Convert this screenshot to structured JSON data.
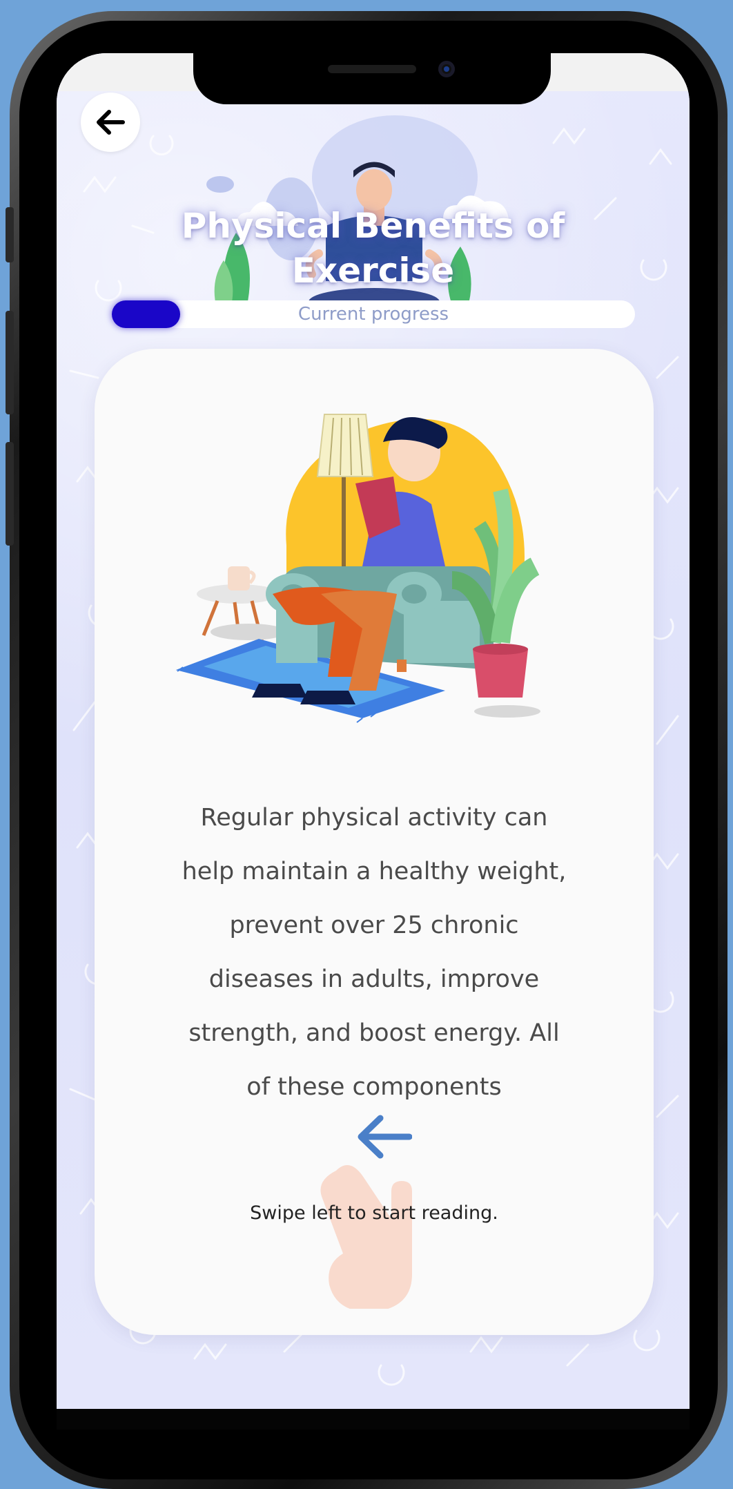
{
  "header": {
    "back_icon": "arrow-left-icon",
    "title_line1": "Physical Benefits  of",
    "title_line2": "Exercise"
  },
  "progress": {
    "label": "Current progress",
    "value_fraction": 0.13,
    "fill_color": "#1a06c8"
  },
  "card": {
    "illustration": "man-reading-on-couch-illustration",
    "body_lines": [
      "Regular physical activity can",
      "help maintain a healthy weight,",
      "prevent over 25 chronic",
      "diseases in adults, improve",
      "strength, and boost energy. All",
      "of these components"
    ],
    "swipe_icon": "arrow-left-icon",
    "hand_icon": "hand-swipe-icon",
    "swipe_hint": "Swipe left to start reading."
  },
  "colors": {
    "background": "#6fa3d8",
    "screen": "#e2e4fb",
    "accent_arrow": "#4a7fc8"
  }
}
